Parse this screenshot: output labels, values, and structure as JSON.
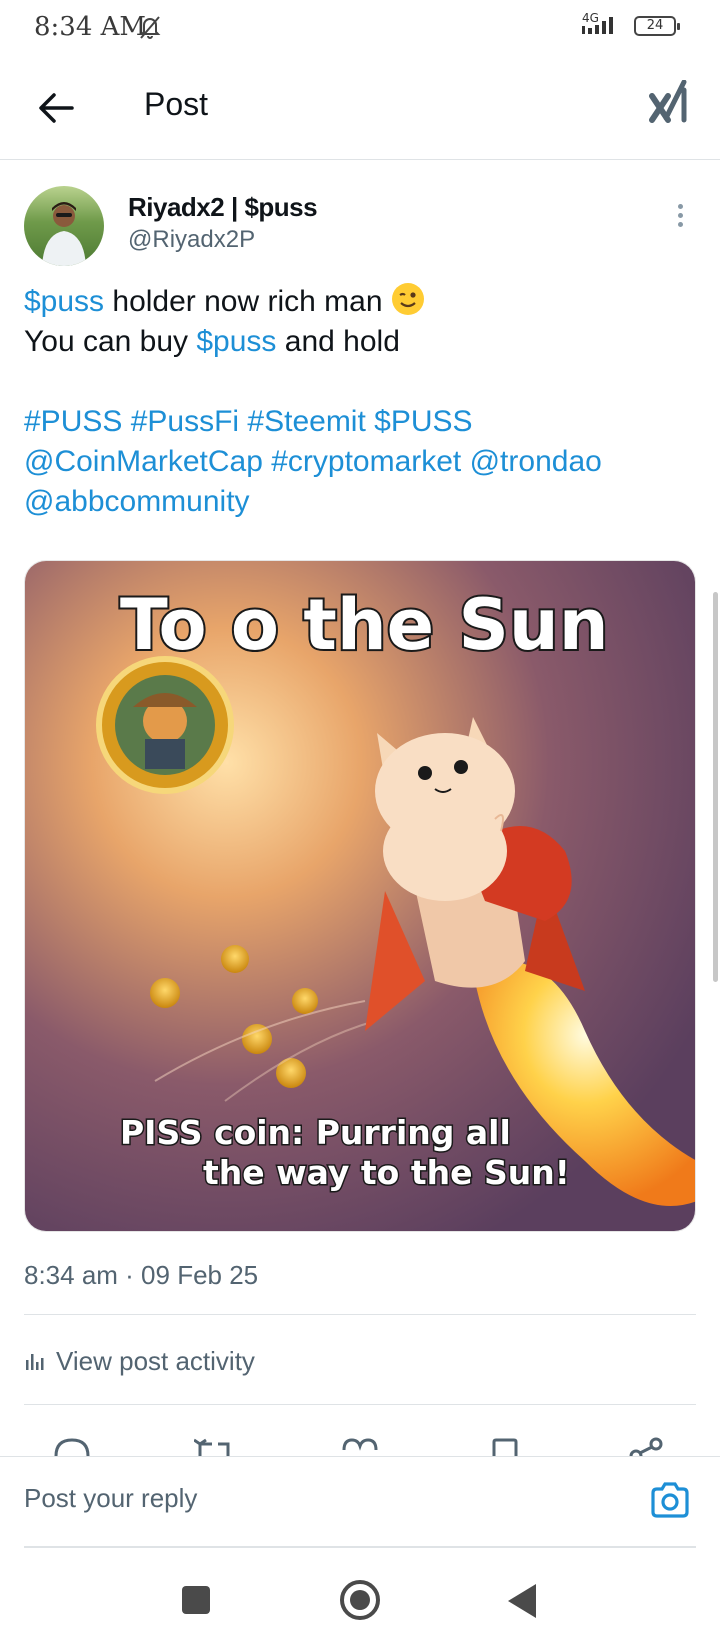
{
  "status_bar": {
    "time": "8:34 AM",
    "network": "4G",
    "battery": "24"
  },
  "header": {
    "title": "Post"
  },
  "post": {
    "author_name": "Riyadx2 | $puss",
    "author_handle": "@Riyadx2P",
    "lines": [
      [
        {
          "t": "$puss",
          "link": true
        },
        {
          "t": " holder now rich man ",
          "link": false
        }
      ],
      [
        {
          "t": "You can buy ",
          "link": false
        },
        {
          "t": "$puss",
          "link": true
        },
        {
          "t": " and hold",
          "link": false
        }
      ],
      [],
      [
        {
          "t": "#PUSS #PussFi #Steemit $PUSS",
          "link": true
        }
      ],
      [
        {
          "t": "@CoinMarketCap #cryptomarket @trondao",
          "link": true
        }
      ],
      [
        {
          "t": "@abbcommunity",
          "link": true
        }
      ]
    ],
    "image": {
      "headline": "To o the Sun",
      "caption_line1": "PISS coin: Purring all",
      "caption_line2": "the way to the Sun!"
    },
    "timestamp": "8:34 am · 09 Feb 25",
    "activity_label": "View post activity"
  },
  "reply": {
    "placeholder": "Post your reply"
  },
  "colors": {
    "link": "#1d8fd6",
    "secondary_text": "#536471",
    "divider": "#dfe3e6"
  }
}
